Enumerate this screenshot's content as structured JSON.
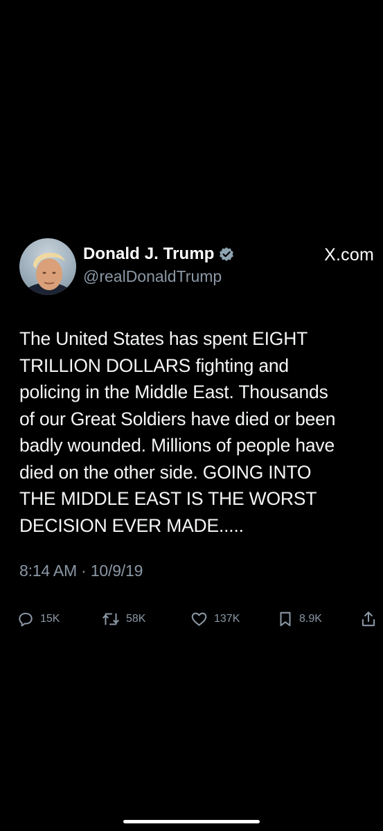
{
  "tweet": {
    "author": {
      "display_name": "Donald J. Trump",
      "handle": "@realDonaldTrump",
      "verified": true,
      "verified_color": "#8ea3b0"
    },
    "brand": "X.com",
    "text": "The United States has spent EIGHT\nTRILLION DOLLARS fighting and\npolicing in the Middle East. Thousands\nof our Great Soldiers have died or been\nbadly wounded. Millions of people have\ndied on the other side. GOING INTO\nTHE MIDDLE EAST IS THE WORST\nDECISION EVER MADE.....",
    "timestamp": "8:14 AM · 10/9/19",
    "actions": {
      "replies": {
        "icon": "reply-icon",
        "count": "15K"
      },
      "reposts": {
        "icon": "repost-icon",
        "count": "58K"
      },
      "likes": {
        "icon": "heart-icon",
        "count": "137K"
      },
      "bookmarks": {
        "icon": "bookmark-icon",
        "count": "8.9K"
      },
      "share": {
        "icon": "share-icon"
      }
    }
  },
  "colors": {
    "background": "#000000",
    "text": "#f5f6f7",
    "secondary_text": "#8b98a5"
  }
}
